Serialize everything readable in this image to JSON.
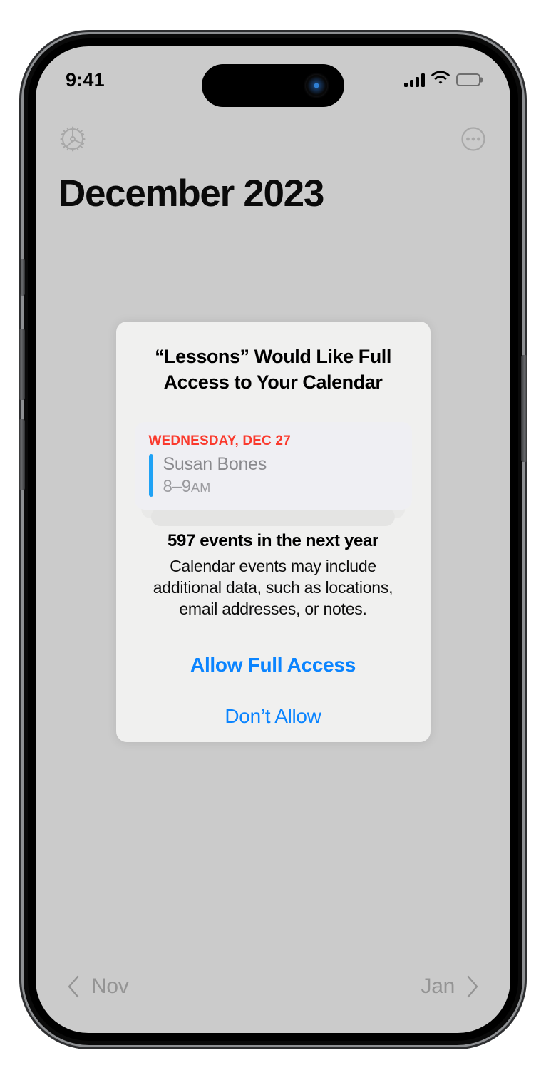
{
  "status_bar": {
    "time": "9:41",
    "cellular_icon": "cellular-signal-icon",
    "wifi_icon": "wifi-icon",
    "battery_icon": "battery-full-icon"
  },
  "header": {
    "settings_icon": "gear-icon",
    "more_icon": "more-options-icon",
    "title": "December 2023"
  },
  "month_nav": {
    "prev_label": "Nov",
    "prev_icon": "chevron-left-icon",
    "next_label": "Jan",
    "next_icon": "chevron-right-icon"
  },
  "alert": {
    "title": "“Lessons” Would Like Full Access to Your Calendar",
    "event_preview": {
      "date": "WEDNESDAY, DEC 27",
      "title": "Susan Bones",
      "time_value": "8–9",
      "time_period": "AM",
      "accent_color": "#1fa2f5",
      "date_color": "#fa3a2d"
    },
    "count_text": "597 events in the next year",
    "description": "Calendar events may include additional data, such as locations, email addresses, or notes.",
    "buttons": [
      {
        "label": "Allow Full Access"
      },
      {
        "label": "Don’t Allow"
      }
    ],
    "button_color": "#0a84ff"
  }
}
